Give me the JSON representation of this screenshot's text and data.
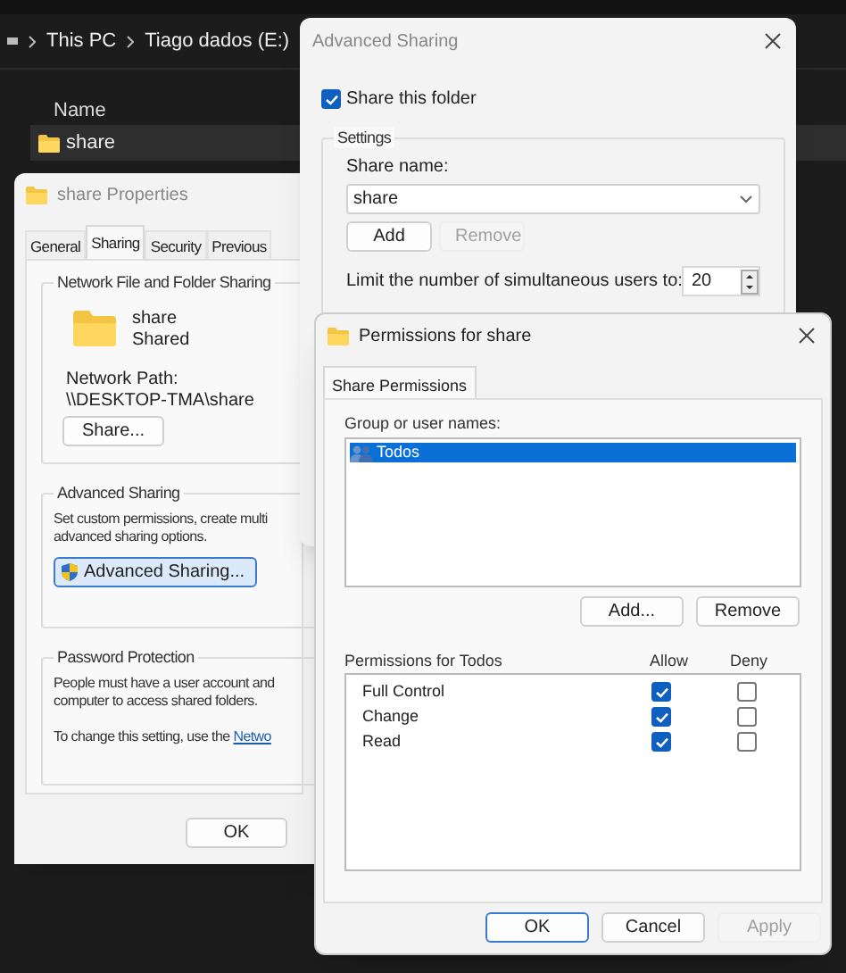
{
  "explorer": {
    "breadcrumb": [
      "This PC",
      "Tiago dados (E:)"
    ],
    "column": "Name",
    "files": [
      {
        "name": "share",
        "selected": true
      }
    ]
  },
  "properties": {
    "title": "share Properties",
    "tabs": [
      {
        "label": "General",
        "selected": false
      },
      {
        "label": "Sharing",
        "selected": true
      },
      {
        "label": "Security",
        "selected": false
      },
      {
        "label": "Previous",
        "selected": false
      }
    ],
    "network_group": {
      "title": "Network File and Folder Sharing",
      "folder_name": "share",
      "status": "Shared",
      "path_label": "Network Path:",
      "path": "\\\\DESKTOP-TMA\\share",
      "button": "Share..."
    },
    "advanced_group": {
      "title": "Advanced Sharing",
      "lines": [
        "Set custom permissions, create multi",
        "advanced sharing options."
      ],
      "button": "Advanced Sharing..."
    },
    "password_group": {
      "title": "Password Protection",
      "lines": [
        "People must have a user account and",
        "computer to access shared folders."
      ],
      "note": "To change this setting, use the",
      "link": "Netwo"
    },
    "buttons": [
      "OK"
    ]
  },
  "advanced_sharing": {
    "title": "Advanced Sharing",
    "share_checkbox": {
      "label": "Share this folder",
      "checked": true
    },
    "settings_title": "Settings",
    "share_name_label": "Share name:",
    "share_name": "share",
    "buttons": [
      {
        "label": "Add",
        "disabled": false
      },
      {
        "label": "Remove",
        "disabled": true
      }
    ],
    "limit_label": "Limit the number of simultaneous users to:",
    "limit_value": "20"
  },
  "permissions": {
    "title": "Permissions for share",
    "tabs": [
      {
        "label": "Share Permissions",
        "selected": true
      }
    ],
    "group_label": "Group or user names:",
    "users": [
      {
        "name": "Todos",
        "selected": true
      }
    ],
    "user_buttons": [
      {
        "label": "Add...",
        "disabled": false
      },
      {
        "label": "Remove",
        "disabled": false
      }
    ],
    "perm_label": "Permissions for Todos",
    "allow_header": "Allow",
    "deny_header": "Deny",
    "rows": [
      {
        "name": "Full Control",
        "allow": true,
        "deny": false
      },
      {
        "name": "Change",
        "allow": true,
        "deny": false
      },
      {
        "name": "Read",
        "allow": true,
        "deny": false
      }
    ],
    "buttons": [
      {
        "label": "OK",
        "disabled": false,
        "default": true
      },
      {
        "label": "Cancel",
        "disabled": false,
        "default": false
      },
      {
        "label": "Apply",
        "disabled": true,
        "default": false
      }
    ]
  }
}
